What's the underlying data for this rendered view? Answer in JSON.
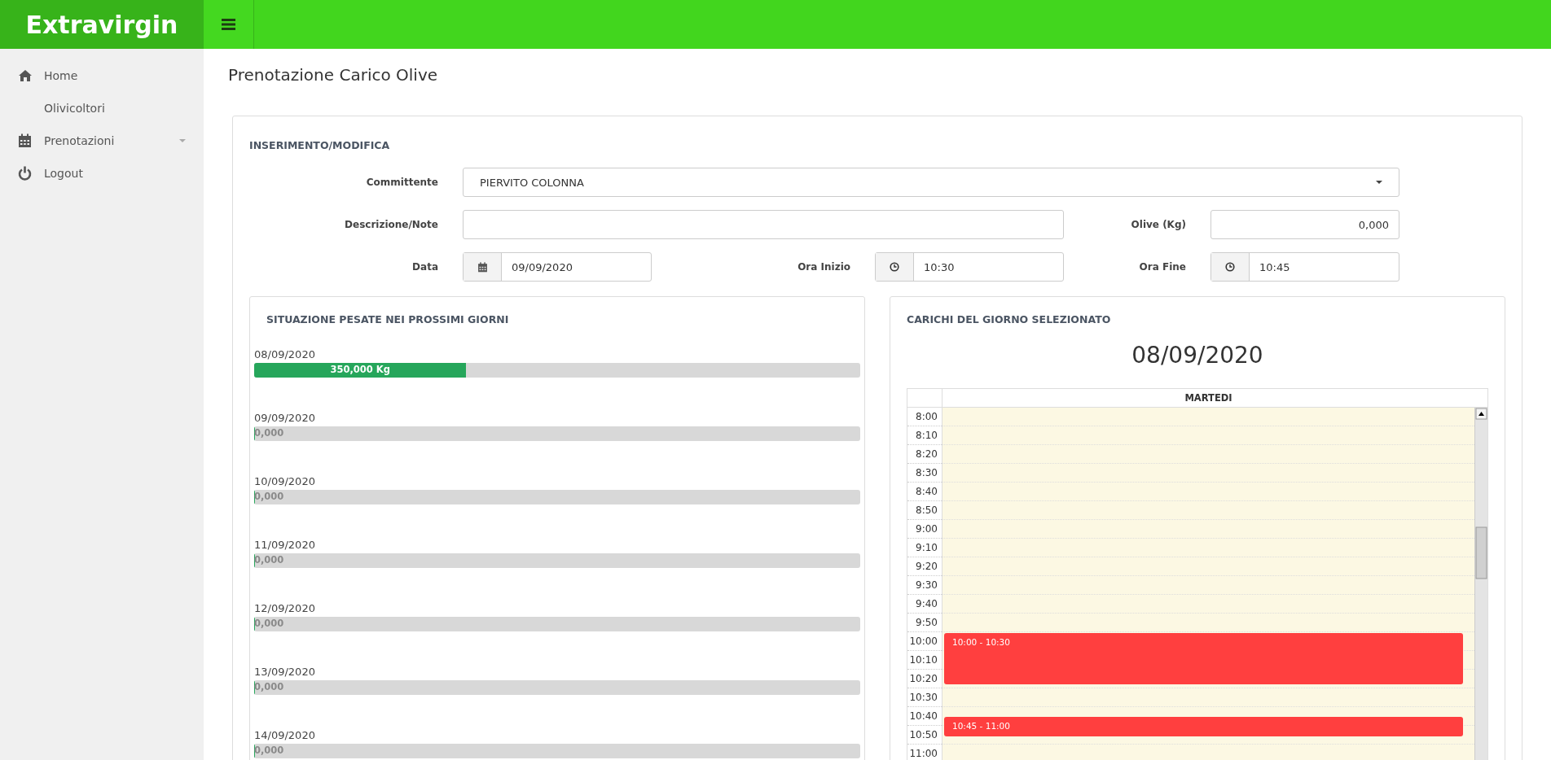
{
  "header": {
    "brand": "Extravirgin"
  },
  "sidebar": {
    "items": [
      {
        "label": "Home",
        "kind": "link"
      },
      {
        "label": "Olivicoltori",
        "kind": "link"
      },
      {
        "label": "Prenotazioni",
        "kind": "submenu"
      },
      {
        "label": "Logout",
        "kind": "link"
      }
    ]
  },
  "page_title": "Prenotazione Carico Olive",
  "form": {
    "title": "INSERIMENTO/MODIFICA",
    "committente": {
      "label": "Committente",
      "value": "PIERVITO COLONNA"
    },
    "descrizione": {
      "label": "Descrizione/Note"
    },
    "olive": {
      "label": "Olive (Kg)",
      "value": "0,000"
    },
    "data": {
      "label": "Data",
      "value": "09/09/2020"
    },
    "ora_inizio": {
      "label": "Ora Inizio",
      "value": "10:30"
    },
    "ora_fine": {
      "label": "Ora Fine",
      "value": "10:45"
    }
  },
  "weights_panel": {
    "title": "SITUAZIONE PESATE NEI PROSSIMI GIORNI",
    "days": [
      {
        "date": "08/09/2020",
        "label": "350,000 Kg",
        "level": 0.35
      },
      {
        "date": "09/09/2020",
        "label": "0,000",
        "level": 0
      },
      {
        "date": "10/09/2020",
        "label": "0,000",
        "level": 0
      },
      {
        "date": "11/09/2020",
        "label": "0,000",
        "level": 0
      },
      {
        "date": "12/09/2020",
        "label": "0,000",
        "level": 0
      },
      {
        "date": "13/09/2020",
        "label": "0,000",
        "level": 0
      },
      {
        "date": "14/09/2020",
        "label": "0,000",
        "level": 0
      }
    ]
  },
  "day_panel": {
    "title": "CARICHI DEL GIORNO SELEZIONATO",
    "date": "08/09/2020",
    "weekday": "MARTEDI",
    "slots": [
      {
        "time": "8:00"
      },
      {
        "time": "8:10"
      },
      {
        "time": "8:20"
      },
      {
        "time": "8:30"
      },
      {
        "time": "8:40"
      },
      {
        "time": "8:50"
      },
      {
        "time": "9:00"
      },
      {
        "time": "9:10"
      },
      {
        "time": "9:20"
      },
      {
        "time": "9:30"
      },
      {
        "time": "9:40"
      },
      {
        "time": "9:50"
      },
      {
        "time": "10:00",
        "event": {
          "label": "10:00 - 10:30",
          "kind": "three-slots"
        }
      },
      {
        "time": "10:10"
      },
      {
        "time": "10:20"
      },
      {
        "time": "10:30"
      },
      {
        "time": "10:40",
        "event": {
          "label": "10:45 - 11:00",
          "kind": "half-offset"
        }
      },
      {
        "time": "10:50"
      },
      {
        "time": "11:00"
      }
    ]
  }
}
